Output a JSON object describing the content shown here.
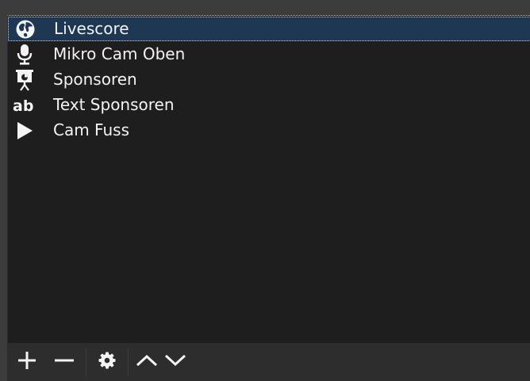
{
  "sources": {
    "items": [
      {
        "label": "Livescore",
        "icon": "globe-icon",
        "selected": true
      },
      {
        "label": "Mikro Cam Oben",
        "icon": "microphone-icon",
        "selected": false
      },
      {
        "label": "Sponsoren",
        "icon": "slideshow-icon",
        "selected": false
      },
      {
        "label": "Text Sponsoren",
        "icon": "text-icon",
        "selected": false
      },
      {
        "label": "Cam Fuss",
        "icon": "play-icon",
        "selected": false
      }
    ]
  },
  "toolbar": {
    "buttons": [
      {
        "icon": "plus-icon"
      },
      {
        "icon": "minus-icon"
      },
      {
        "icon": "gear-icon"
      },
      {
        "icon": "chevron-up-icon"
      },
      {
        "icon": "chevron-down-icon"
      }
    ]
  },
  "colors": {
    "panel_background": "#1e1e1e",
    "selected_row": "#1e3854",
    "toolbar_background": "#2d2d2d",
    "text": "#f3f3f3"
  }
}
